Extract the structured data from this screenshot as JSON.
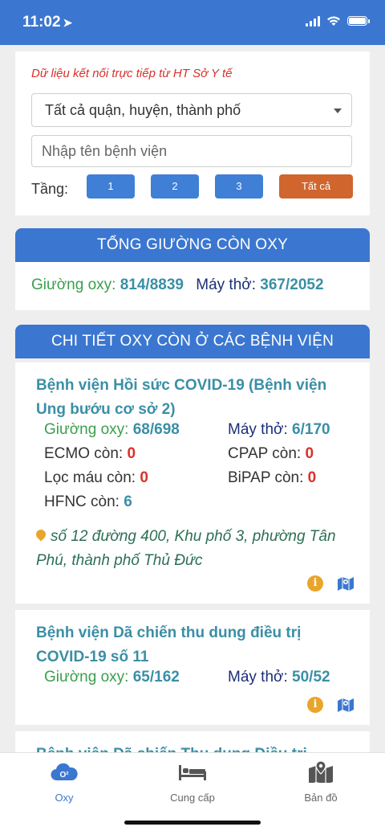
{
  "status_bar": {
    "time": "11:02",
    "location_arrow": "location-arrow-icon"
  },
  "filters": {
    "live_note": "Dữ liệu kết nối trực tiếp từ HT Sở Y tế",
    "district_select": "Tất cả quận, huyện, thành phố",
    "search_placeholder": "Nhập tên bệnh viện",
    "floor_label": "Tầng:",
    "floor_buttons": [
      "1",
      "2",
      "3",
      "Tất cả"
    ]
  },
  "summary": {
    "title": "TỔNG GIƯỜNG CÒN OXY",
    "oxygen_beds_label": "Giường oxy:",
    "oxygen_beds_value": "814/8839",
    "ventilators_label": "Máy thở:",
    "ventilators_value": "367/2052"
  },
  "detail": {
    "title": "CHI TIẾT OXY CÒN Ở CÁC BỆNH VIỆN",
    "hospitals": [
      {
        "name": "Bệnh viện Hồi sức COVID-19 (Bệnh viện Ung bướu cơ sở 2)",
        "oxygen_beds_label": "Giường oxy:",
        "oxygen_beds": "68/698",
        "ventilators_label": "Máy thở:",
        "ventilators": "6/170",
        "ecmo_label": "ECMO còn:",
        "ecmo": "0",
        "cpap_label": "CPAP còn:",
        "cpap": "0",
        "dialysis_label": "Lọc máu còn:",
        "dialysis": "0",
        "bipap_label": "BiPAP còn:",
        "bipap": "0",
        "hfnc_label": "HFNC còn:",
        "hfnc": "6",
        "address": "số 12 đường 400, Khu phố 3, phường Tân Phú, thành phố Thủ Đức"
      },
      {
        "name": "Bệnh viện Dã chiến thu dung điều trị COVID-19 số 11",
        "oxygen_beds_label": "Giường oxy:",
        "oxygen_beds": "65/162",
        "ventilators_label": "Máy thở:",
        "ventilators": "50/52"
      },
      {
        "name": "Bệnh viện Dã chiến Thu dung Điều trị"
      }
    ]
  },
  "tab_bar": {
    "tabs": [
      {
        "label": "Oxy",
        "icon": "oxygen-cloud-icon",
        "active": true
      },
      {
        "label": "Cung cấp",
        "icon": "bed-icon",
        "active": false
      },
      {
        "label": "Bản đồ",
        "icon": "map-pin-icon",
        "active": false
      }
    ]
  },
  "colors": {
    "primary": "#3b77d0",
    "accent_orange": "#d0652e",
    "value_teal": "#3a8fa6",
    "alert_red": "#d9312b",
    "label_green": "#3a9f4d"
  }
}
